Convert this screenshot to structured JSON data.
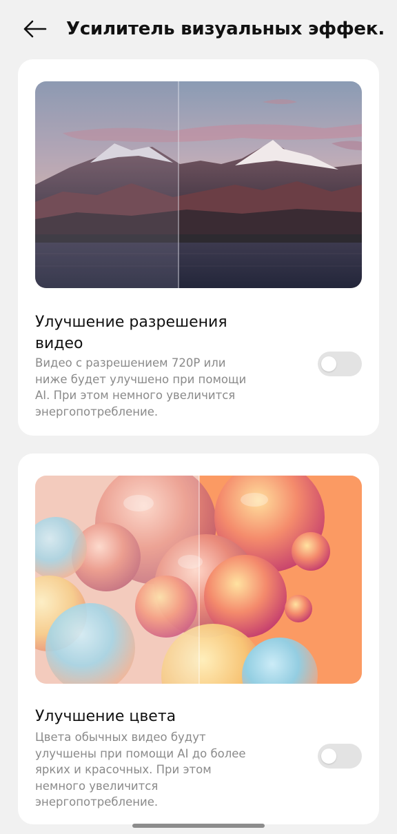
{
  "header": {
    "title": "Усилитель визуальных эффек..."
  },
  "features": [
    {
      "title": "Улучшение разрешения видео",
      "description": "Видео с разрешением 720P или ниже будет улучшено при помощи AI. При этом немного увеличится энергопотребление.",
      "enabled": false
    },
    {
      "title": "Улучшение цвета",
      "description": "Цвета обычных видео будут улучшены при помощи AI до более ярких и красочных. При этом немного увеличится энергопотребление.",
      "enabled": false
    }
  ],
  "colors": {
    "background": "#f1f1f1",
    "card": "#ffffff",
    "toggle_off": "#e3e3e3",
    "secondary_text": "#8a8a8a"
  }
}
